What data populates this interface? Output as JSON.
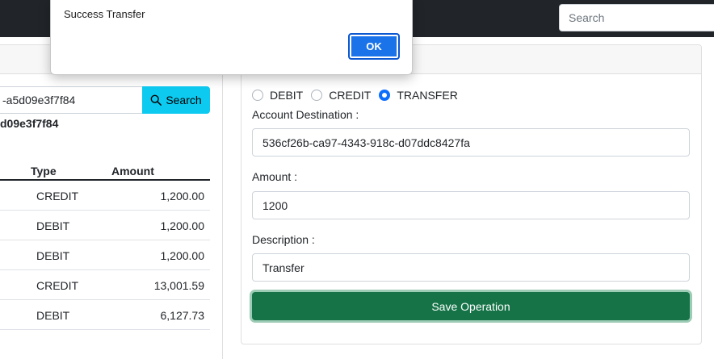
{
  "navbar": {
    "search_placeholder": "Search"
  },
  "account_panel": {
    "account_input_value": "-a5d09e3f7f84",
    "search_button_label": "Search",
    "account_id_text": "d09e3f7f84",
    "table": {
      "headers": {
        "type": "Type",
        "amount": "Amount"
      },
      "rows": [
        {
          "type": "CREDIT",
          "amount": "1,200.00"
        },
        {
          "type": "DEBIT",
          "amount": "1,200.00"
        },
        {
          "type": "DEBIT",
          "amount": "1,200.00"
        },
        {
          "type": "CREDIT",
          "amount": "13,001.59"
        },
        {
          "type": "DEBIT",
          "amount": "6,127.73"
        }
      ]
    }
  },
  "operation_form": {
    "radio_debit": "DEBIT",
    "radio_credit": "CREDIT",
    "radio_transfer": "TRANSFER",
    "selected_operation": "TRANSFER",
    "account_destination_label": "Account Destination :",
    "account_destination_value": "536cf26b-ca97-4343-918c-d07ddc8427fa",
    "amount_label": "Amount :",
    "amount_value": "1200",
    "description_label": "Description :",
    "description_value": "Transfer",
    "save_button_label": "Save Operation"
  },
  "alert_dialog": {
    "message": "Success Transfer",
    "ok_label": "OK"
  },
  "colors": {
    "navbar": "#212529",
    "search_button": "#0dcaf0",
    "radio_checked": "#0d6efd",
    "save_button": "#157347",
    "ok_button": "#1a73e8"
  }
}
